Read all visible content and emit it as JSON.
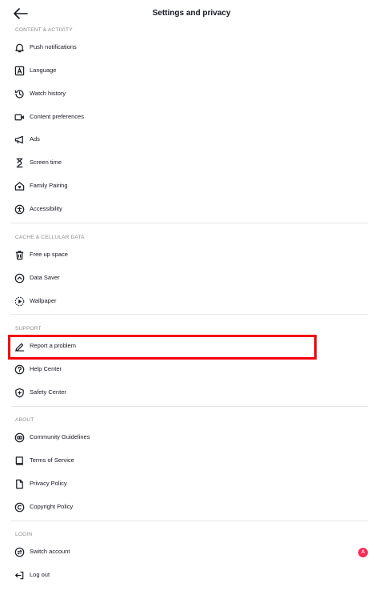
{
  "header": {
    "title": "Settings and privacy"
  },
  "sections": {
    "content": {
      "title": "CONTENT & ACTIVITY",
      "items": [
        "Push notifications",
        "Language",
        "Watch history",
        "Content preferences",
        "Ads",
        "Screen time",
        "Family Pairing",
        "Accessibility"
      ]
    },
    "cache": {
      "title": "CACHE & CELLULAR DATA",
      "items": [
        "Free up space",
        "Data Saver",
        "Wallpaper"
      ]
    },
    "support": {
      "title": "SUPPORT",
      "items": [
        "Report a problem",
        "Help Center",
        "Safety Center"
      ]
    },
    "about": {
      "title": "ABOUT",
      "items": [
        "Community Guidelines",
        "Terms of Service",
        "Privacy Policy",
        "Copyright Policy"
      ]
    },
    "login": {
      "title": "LOGIN",
      "items": [
        "Switch account",
        "Log out"
      ]
    }
  },
  "badge": {
    "text": "A"
  },
  "colors": {
    "highlight": "#f4000a",
    "badge": "#fe2c55",
    "section_text": "#8a8b91",
    "divider": "#e6e6e8"
  }
}
